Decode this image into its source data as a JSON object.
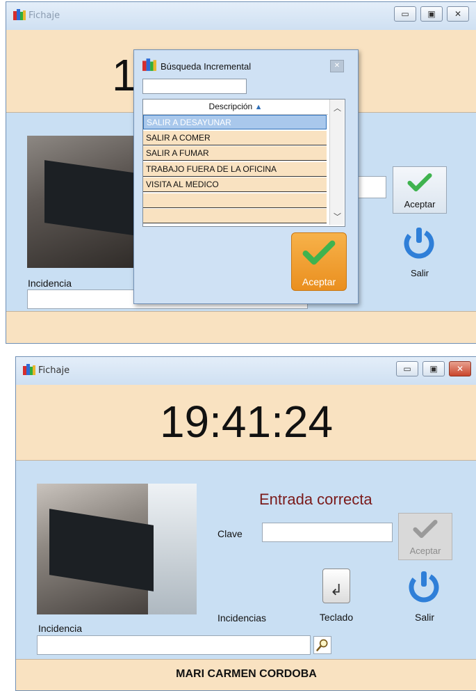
{
  "top_window": {
    "title": "Fichaje",
    "clock_partial": "1",
    "incidencia_label": "Incidencia",
    "salir_label": "Salir",
    "aceptar_label": "Aceptar",
    "popup": {
      "title": "Búsqueda Incremental",
      "search_value": "",
      "column_header": "Descripción",
      "rows": [
        "SALIR A DESAYUNAR",
        "SALIR A COMER",
        "SALIR A FUMAR",
        "TRABAJO FUERA DE LA OFICINA",
        "VISITA AL MEDICO",
        "",
        ""
      ],
      "selected_row": "SALIR A DESAYUNAR",
      "aceptar_label": "Aceptar"
    }
  },
  "bottom_window": {
    "title": "Fichaje",
    "clock": "19:41:24",
    "status_message": "Entrada correcta",
    "clave_label": "Clave",
    "clave_value": "",
    "aceptar_label": "Aceptar",
    "incidencias_label": "Incidencias",
    "teclado_label": "Teclado",
    "salir_label": "Salir",
    "incidencia_label": "Incidencia",
    "incidencia_value": "",
    "user_name": "MARI CARMEN CORDOBA"
  },
  "colors": {
    "panel_blue": "#c9dff3",
    "band_peach": "#f9e2c1",
    "status_text": "#7a1a1a",
    "accept_orange": "#f0a33a",
    "check_green": "#3fb34f"
  },
  "icons": [
    "app-icon",
    "minimize-icon",
    "maximize-icon",
    "close-icon",
    "check-icon",
    "power-icon",
    "enter-key-icon",
    "search-icon",
    "sort-up-icon",
    "scroll-up-icon",
    "scroll-down-icon"
  ]
}
